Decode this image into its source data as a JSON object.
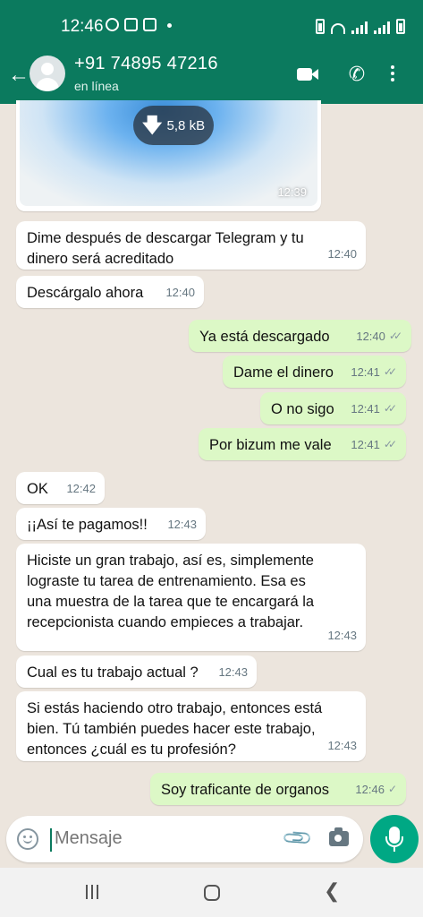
{
  "status_bar": {
    "time": "12:46"
  },
  "header": {
    "back_icon": "back-arrow-icon",
    "contact_name": "+91 74895 47216",
    "contact_status": "en línea",
    "video_icon": "video-call-icon",
    "call_icon": "phone-icon",
    "menu_icon": "more-vert-icon"
  },
  "image_message": {
    "download_size": "5,8 kB",
    "time": "12:39"
  },
  "messages": [
    {
      "dir": "in",
      "text": "Dime después de descargar Telegram y tu\ndinero será acreditado",
      "time": "12:40"
    },
    {
      "dir": "in",
      "text": "Descárgalo ahora",
      "time": "12:40"
    },
    {
      "dir": "out",
      "text": "Ya está descargado",
      "time": "12:40",
      "status": "read"
    },
    {
      "dir": "out",
      "text": "Dame el dinero",
      "time": "12:41",
      "status": "read"
    },
    {
      "dir": "out",
      "text": "O no sigo",
      "time": "12:41",
      "status": "read"
    },
    {
      "dir": "out",
      "text": "Por bizum me vale",
      "time": "12:41",
      "status": "read"
    },
    {
      "dir": "in",
      "text": "OK",
      "time": "12:42"
    },
    {
      "dir": "in",
      "text": "¡¡Así te pagamos!!",
      "time": "12:43"
    },
    {
      "dir": "in",
      "text": "Hiciste un gran trabajo, así es, simplemente\nlograste tu tarea de entrenamiento. Esa es\nuna muestra de la tarea que te encargará la\nrecepcionista cuando empieces a trabajar.",
      "time": "12:43"
    },
    {
      "dir": "in",
      "text": "Cual es tu trabajo actual ?",
      "time": "12:43"
    },
    {
      "dir": "in",
      "text": "Si estás haciendo otro trabajo, entonces está\nbien. Tú también puedes hacer este trabajo,\nentonces ¿cuál es tu profesión?",
      "time": "12:43"
    },
    {
      "dir": "out",
      "text": "Soy traficante de organos",
      "time": "12:46",
      "status": "delivered"
    }
  ],
  "input": {
    "placeholder": "Mensaje"
  },
  "colors": {
    "header": "#0b7a5e",
    "outgoing_bubble": "#dcf8c6",
    "incoming_bubble": "#ffffff",
    "chat_background": "#ece5dd",
    "mic_button": "#00a884"
  }
}
